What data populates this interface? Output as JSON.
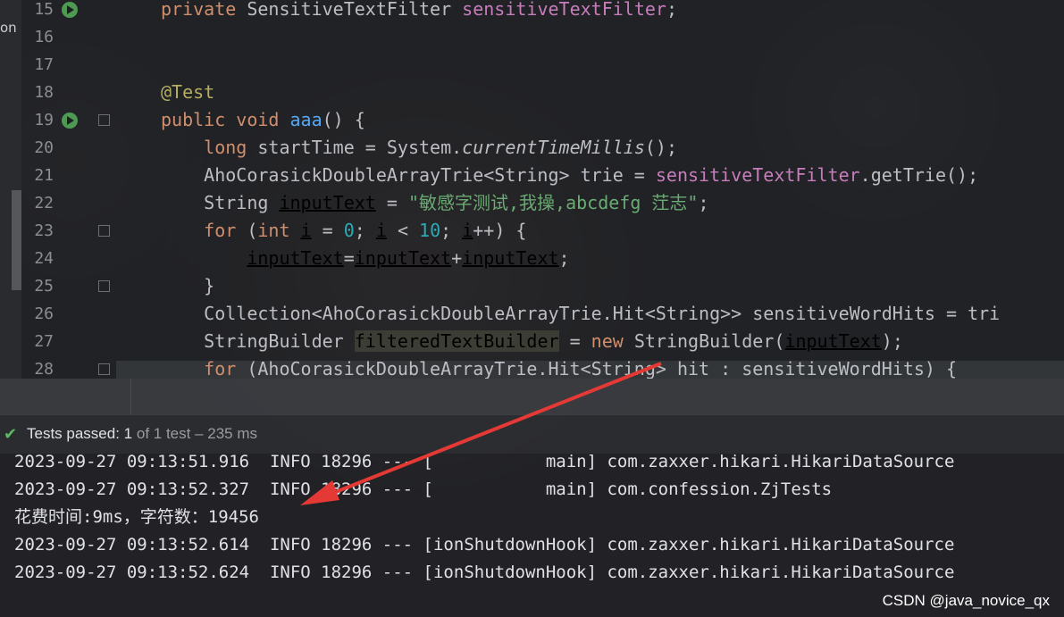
{
  "editor": {
    "side_text": "on",
    "lines": [
      {
        "no": "15",
        "parts": [
          [
            "kw",
            "private "
          ],
          [
            "txt",
            "SensitiveTextFilter "
          ],
          [
            "field",
            "sensitiveTextFilter"
          ],
          [
            "txt",
            ";"
          ]
        ]
      },
      {
        "no": "16",
        "parts": []
      },
      {
        "no": "17",
        "parts": []
      },
      {
        "no": "18",
        "parts": [
          [
            "ann",
            "@Test"
          ]
        ]
      },
      {
        "no": "19",
        "parts": [
          [
            "kw",
            "public void "
          ],
          [
            "fn",
            "aaa"
          ],
          [
            "txt",
            "() {"
          ]
        ]
      },
      {
        "no": "20",
        "parts": [
          [
            "kw",
            "    long "
          ],
          [
            "txt",
            "startTime = System."
          ],
          [
            "ital",
            "currentTimeMillis"
          ],
          [
            "txt",
            "();"
          ]
        ]
      },
      {
        "no": "21",
        "parts": [
          [
            "txt",
            "    AhoCorasickDoubleArrayTrie<String> trie = "
          ],
          [
            "field",
            "sensitiveTextFilter"
          ],
          [
            "txt",
            ".getTrie();"
          ]
        ]
      },
      {
        "no": "22",
        "parts": [
          [
            "txt",
            "    String "
          ],
          [
            "ul",
            "inputText"
          ],
          [
            "txt",
            " = "
          ],
          [
            "str",
            "\"敏感字测试,我操,abcdefg 茳志\""
          ],
          [
            "txt",
            ";"
          ]
        ]
      },
      {
        "no": "23",
        "parts": [
          [
            "kw",
            "    for "
          ],
          [
            "txt",
            "("
          ],
          [
            "kw",
            "int "
          ],
          [
            "ul",
            "i"
          ],
          [
            "txt",
            " = "
          ],
          [
            "num",
            "0"
          ],
          [
            "txt",
            "; "
          ],
          [
            "ul",
            "i"
          ],
          [
            "txt",
            " < "
          ],
          [
            "num",
            "10"
          ],
          [
            "txt",
            "; "
          ],
          [
            "ul",
            "i"
          ],
          [
            "txt",
            "++) {"
          ]
        ]
      },
      {
        "no": "24",
        "parts": [
          [
            "txt",
            "        "
          ],
          [
            "ul",
            "inputText"
          ],
          [
            "txt",
            "="
          ],
          [
            "ul",
            "inputText"
          ],
          [
            "txt",
            "+"
          ],
          [
            "ul",
            "inputText"
          ],
          [
            "txt",
            ";"
          ]
        ]
      },
      {
        "no": "25",
        "parts": [
          [
            "txt",
            "    }"
          ]
        ]
      },
      {
        "no": "26",
        "parts": [
          [
            "txt",
            "    Collection<AhoCorasickDoubleArrayTrie.Hit<String>> sensitiveWordHits = tri"
          ]
        ]
      },
      {
        "no": "27",
        "parts": [
          [
            "txt",
            "    StringBuilder "
          ],
          [
            "hl",
            "filteredTextBuilder"
          ],
          [
            "txt",
            " = "
          ],
          [
            "kw",
            "new "
          ],
          [
            "txt",
            "StringBuilder("
          ],
          [
            "ul",
            "inputText"
          ],
          [
            "txt",
            ");"
          ]
        ]
      },
      {
        "no": "28",
        "parts": [
          [
            "kw",
            "    for "
          ],
          [
            "txt",
            "(AhoCorasickDoubleArrayTrie.Hit<String> hit : sensitiveWordHits) {"
          ]
        ]
      }
    ]
  },
  "status": {
    "check_icon": "check-icon",
    "main": "Tests passed: ",
    "count": "1",
    "sub": " of 1 test – 235 ms"
  },
  "console": {
    "lines": [
      "2023-09-27 09:13:51.916  INFO 18296 --- [           main] com.zaxxer.hikari.HikariDataSource",
      "2023-09-27 09:13:52.327  INFO 18296 --- [           main] com.confession.ZjTests",
      "花费时间:9ms，字符数：19456",
      "2023-09-27 09:13:52.614  INFO 18296 --- [ionShutdownHook] com.zaxxer.hikari.HikariDataSource",
      "2023-09-27 09:13:52.624  INFO 18296 --- [ionShutdownHook] com.zaxxer.hikari.HikariDataSource"
    ]
  },
  "watermark": "CSDN @java_novice_qx",
  "annotation": {
    "arrow_color": "#e53935"
  },
  "colors": {
    "pass_green": "#5fb865",
    "keyword": "#cf8e6d",
    "field": "#c77dbb",
    "string": "#6aab73"
  }
}
